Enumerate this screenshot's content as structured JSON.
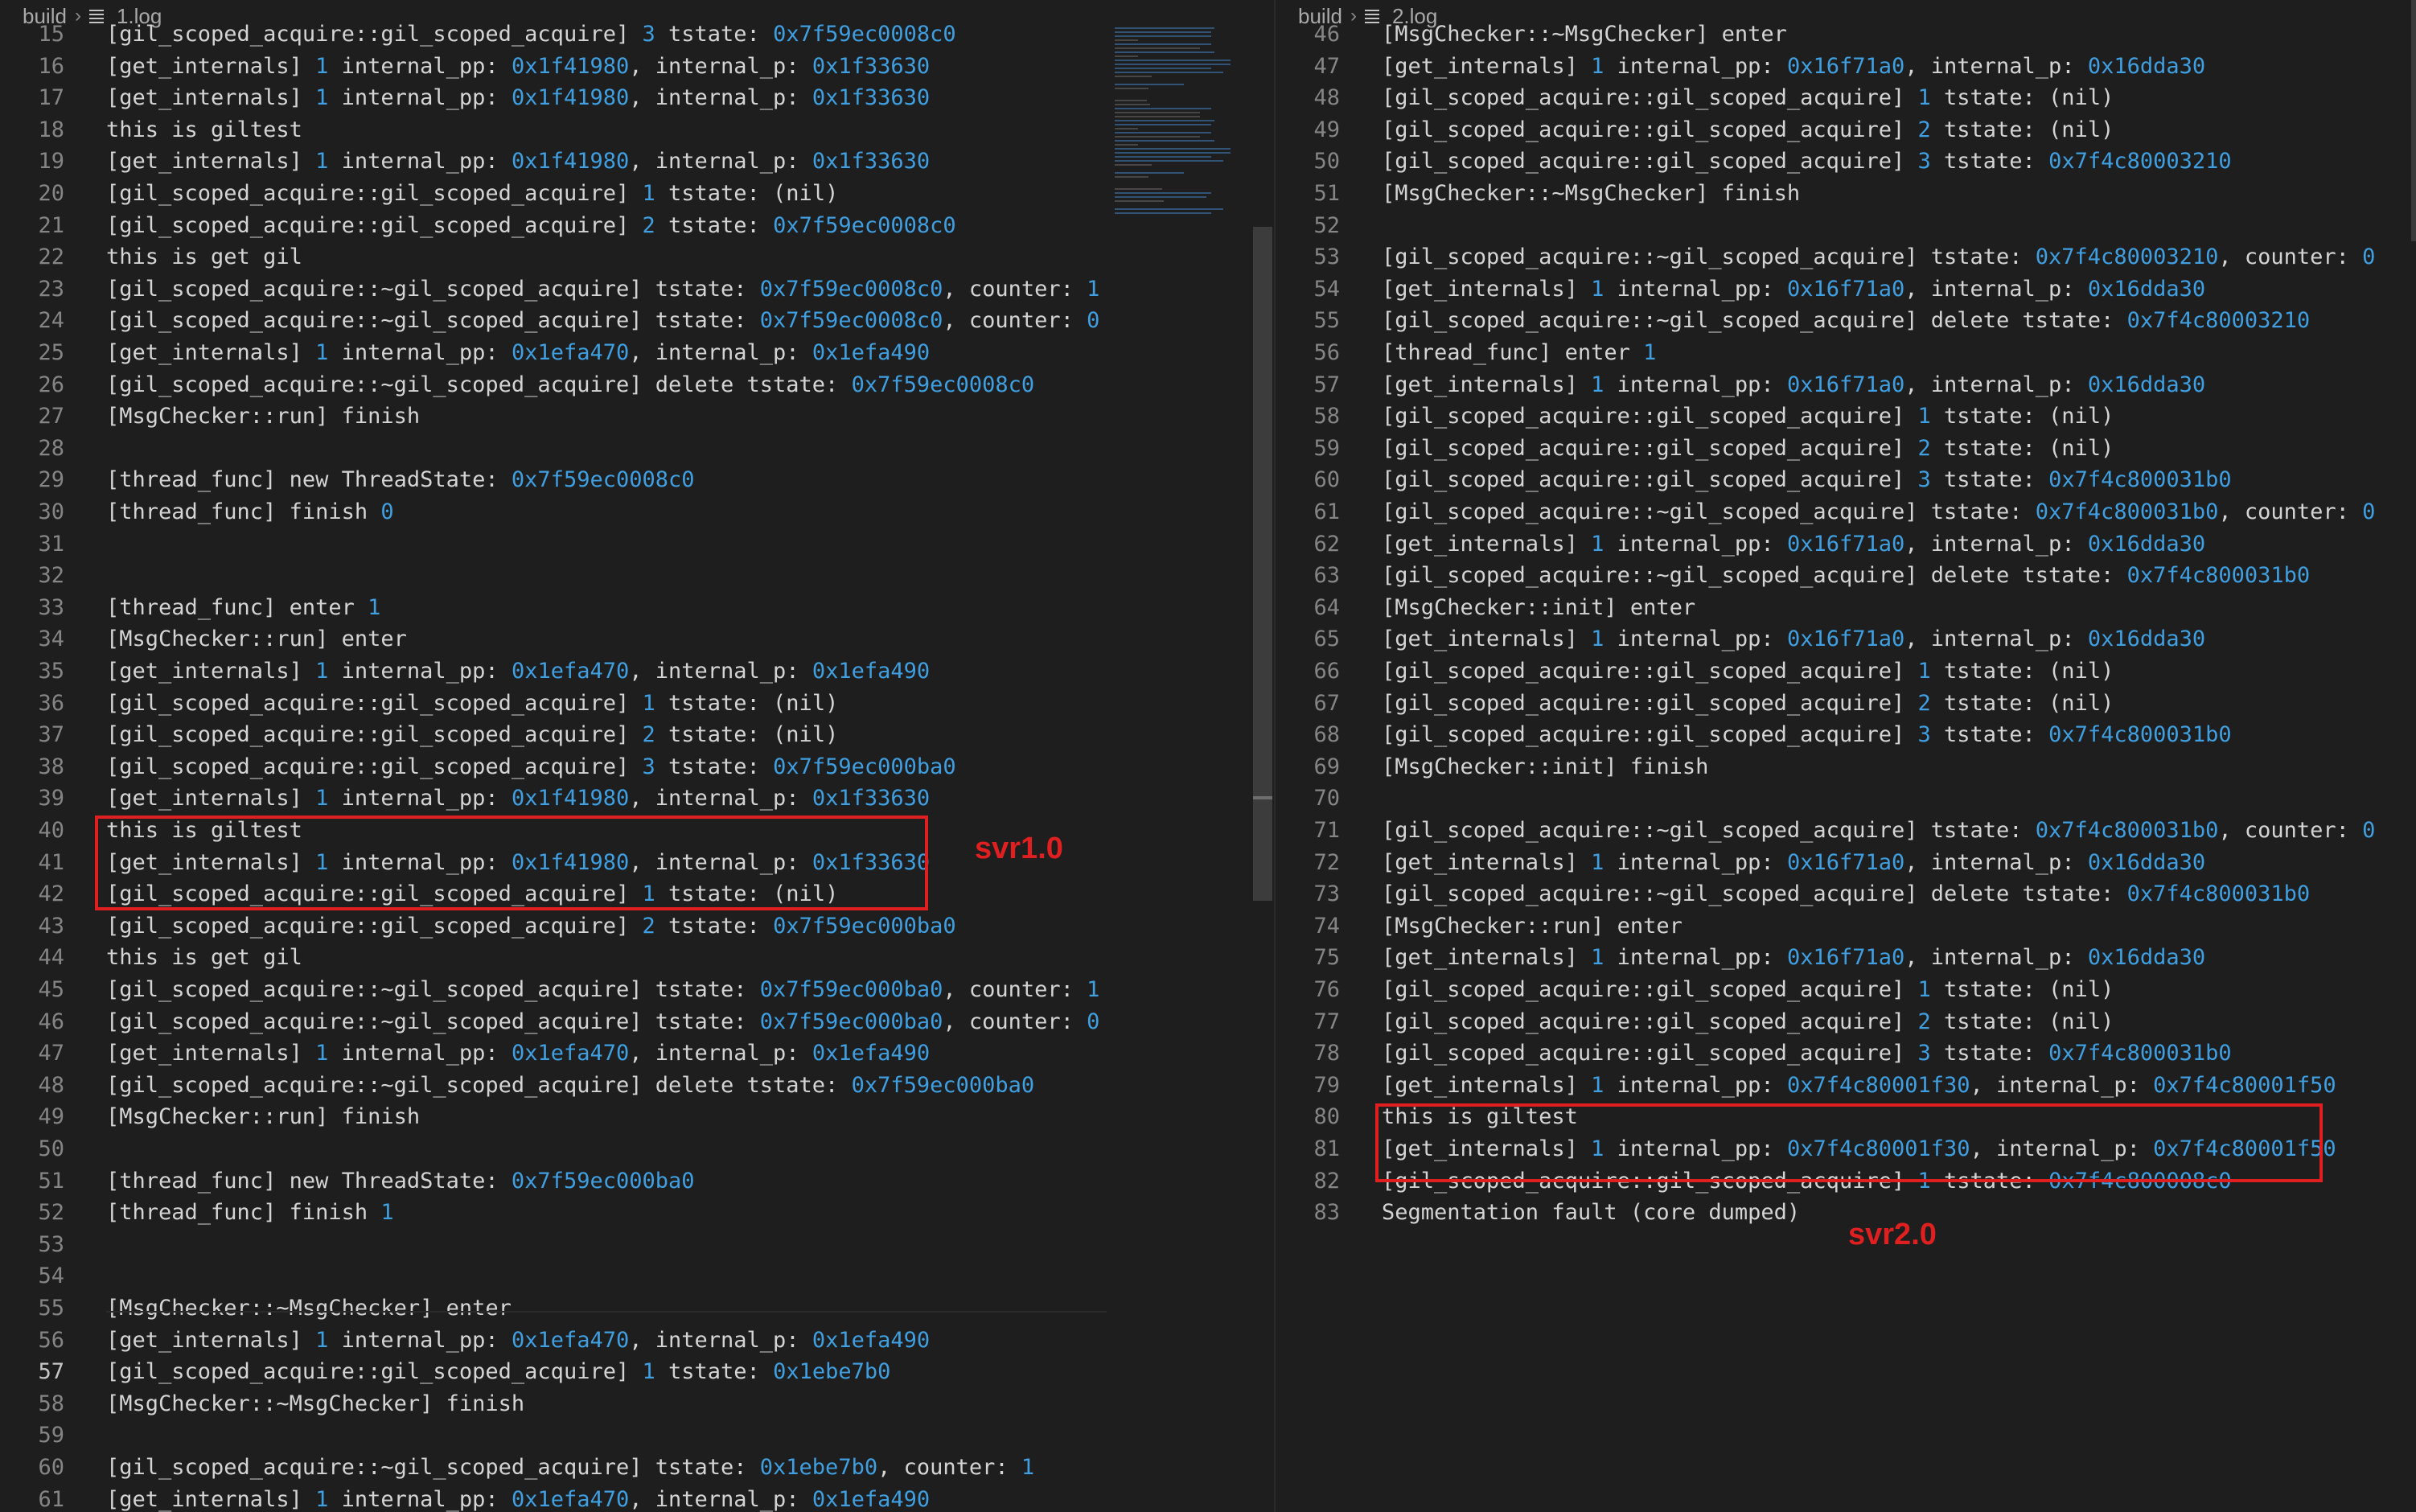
{
  "left": {
    "breadcrumb": {
      "folder": "build",
      "file": "1.log"
    },
    "annotation": "svr1.0",
    "active_line": 57,
    "lines": [
      {
        "n": 15,
        "t": "[gil_scoped_acquire::gil_scoped_acquire] 3 tstate: 0x7f59ec0008c0"
      },
      {
        "n": 16,
        "t": "[get_internals] 1 internal_pp: 0x1f41980, internal_p: 0x1f33630"
      },
      {
        "n": 17,
        "t": "[get_internals] 1 internal_pp: 0x1f41980, internal_p: 0x1f33630"
      },
      {
        "n": 18,
        "t": "this is giltest"
      },
      {
        "n": 19,
        "t": "[get_internals] 1 internal_pp: 0x1f41980, internal_p: 0x1f33630"
      },
      {
        "n": 20,
        "t": "[gil_scoped_acquire::gil_scoped_acquire] 1 tstate: (nil)"
      },
      {
        "n": 21,
        "t": "[gil_scoped_acquire::gil_scoped_acquire] 2 tstate: 0x7f59ec0008c0"
      },
      {
        "n": 22,
        "t": "this is get gil"
      },
      {
        "n": 23,
        "t": "[gil_scoped_acquire::~gil_scoped_acquire] tstate: 0x7f59ec0008c0, counter: 1"
      },
      {
        "n": 24,
        "t": "[gil_scoped_acquire::~gil_scoped_acquire] tstate: 0x7f59ec0008c0, counter: 0"
      },
      {
        "n": 25,
        "t": "[get_internals] 1 internal_pp: 0x1efa470, internal_p: 0x1efa490"
      },
      {
        "n": 26,
        "t": "[gil_scoped_acquire::~gil_scoped_acquire] delete tstate: 0x7f59ec0008c0"
      },
      {
        "n": 27,
        "t": "[MsgChecker::run] finish"
      },
      {
        "n": 28,
        "t": ""
      },
      {
        "n": 29,
        "t": "[thread_func] new ThreadState: 0x7f59ec0008c0"
      },
      {
        "n": 30,
        "t": "[thread_func] finish 0"
      },
      {
        "n": 31,
        "t": ""
      },
      {
        "n": 32,
        "t": ""
      },
      {
        "n": 33,
        "t": "[thread_func] enter 1"
      },
      {
        "n": 34,
        "t": "[MsgChecker::run] enter"
      },
      {
        "n": 35,
        "t": "[get_internals] 1 internal_pp: 0x1efa470, internal_p: 0x1efa490"
      },
      {
        "n": 36,
        "t": "[gil_scoped_acquire::gil_scoped_acquire] 1 tstate: (nil)"
      },
      {
        "n": 37,
        "t": "[gil_scoped_acquire::gil_scoped_acquire] 2 tstate: (nil)"
      },
      {
        "n": 38,
        "t": "[gil_scoped_acquire::gil_scoped_acquire] 3 tstate: 0x7f59ec000ba0"
      },
      {
        "n": 39,
        "t": "[get_internals] 1 internal_pp: 0x1f41980, internal_p: 0x1f33630"
      },
      {
        "n": 40,
        "t": "this is giltest"
      },
      {
        "n": 41,
        "t": "[get_internals] 1 internal_pp: 0x1f41980, internal_p: 0x1f33630"
      },
      {
        "n": 42,
        "t": "[gil_scoped_acquire::gil_scoped_acquire] 1 tstate: (nil)"
      },
      {
        "n": 43,
        "t": "[gil_scoped_acquire::gil_scoped_acquire] 2 tstate: 0x7f59ec000ba0"
      },
      {
        "n": 44,
        "t": "this is get gil"
      },
      {
        "n": 45,
        "t": "[gil_scoped_acquire::~gil_scoped_acquire] tstate: 0x7f59ec000ba0, counter: 1"
      },
      {
        "n": 46,
        "t": "[gil_scoped_acquire::~gil_scoped_acquire] tstate: 0x7f59ec000ba0, counter: 0"
      },
      {
        "n": 47,
        "t": "[get_internals] 1 internal_pp: 0x1efa470, internal_p: 0x1efa490"
      },
      {
        "n": 48,
        "t": "[gil_scoped_acquire::~gil_scoped_acquire] delete tstate: 0x7f59ec000ba0"
      },
      {
        "n": 49,
        "t": "[MsgChecker::run] finish"
      },
      {
        "n": 50,
        "t": ""
      },
      {
        "n": 51,
        "t": "[thread_func] new ThreadState: 0x7f59ec000ba0"
      },
      {
        "n": 52,
        "t": "[thread_func] finish 1"
      },
      {
        "n": 53,
        "t": ""
      },
      {
        "n": 54,
        "t": ""
      },
      {
        "n": 55,
        "t": "[MsgChecker::~MsgChecker] enter"
      },
      {
        "n": 56,
        "t": "[get_internals] 1 internal_pp: 0x1efa470, internal_p: 0x1efa490"
      },
      {
        "n": 57,
        "t": "[gil_scoped_acquire::gil_scoped_acquire] 1 tstate: 0x1ebe7b0"
      },
      {
        "n": 58,
        "t": "[MsgChecker::~MsgChecker] finish"
      },
      {
        "n": 59,
        "t": ""
      },
      {
        "n": 60,
        "t": "[gil_scoped_acquire::~gil_scoped_acquire] tstate: 0x1ebe7b0, counter: 1"
      },
      {
        "n": 61,
        "t": "[get_internals] 1 internal_pp: 0x1efa470, internal_p: 0x1efa490"
      },
      {
        "n": 62,
        "t": ""
      }
    ]
  },
  "right": {
    "breadcrumb": {
      "folder": "build",
      "file": "2.log"
    },
    "annotation": "svr2.0",
    "lines": [
      {
        "n": 46,
        "t": "[MsgChecker::~MsgChecker] enter"
      },
      {
        "n": 47,
        "t": "[get_internals] 1 internal_pp: 0x16f71a0, internal_p: 0x16dda30"
      },
      {
        "n": 48,
        "t": "[gil_scoped_acquire::gil_scoped_acquire] 1 tstate: (nil)"
      },
      {
        "n": 49,
        "t": "[gil_scoped_acquire::gil_scoped_acquire] 2 tstate: (nil)"
      },
      {
        "n": 50,
        "t": "[gil_scoped_acquire::gil_scoped_acquire] 3 tstate: 0x7f4c80003210"
      },
      {
        "n": 51,
        "t": "[MsgChecker::~MsgChecker] finish"
      },
      {
        "n": 52,
        "t": ""
      },
      {
        "n": 53,
        "t": "[gil_scoped_acquire::~gil_scoped_acquire] tstate: 0x7f4c80003210, counter: 0"
      },
      {
        "n": 54,
        "t": "[get_internals] 1 internal_pp: 0x16f71a0, internal_p: 0x16dda30"
      },
      {
        "n": 55,
        "t": "[gil_scoped_acquire::~gil_scoped_acquire] delete tstate: 0x7f4c80003210"
      },
      {
        "n": 56,
        "t": "[thread_func] enter 1"
      },
      {
        "n": 57,
        "t": "[get_internals] 1 internal_pp: 0x16f71a0, internal_p: 0x16dda30"
      },
      {
        "n": 58,
        "t": "[gil_scoped_acquire::gil_scoped_acquire] 1 tstate: (nil)"
      },
      {
        "n": 59,
        "t": "[gil_scoped_acquire::gil_scoped_acquire] 2 tstate: (nil)"
      },
      {
        "n": 60,
        "t": "[gil_scoped_acquire::gil_scoped_acquire] 3 tstate: 0x7f4c800031b0"
      },
      {
        "n": 61,
        "t": "[gil_scoped_acquire::~gil_scoped_acquire] tstate: 0x7f4c800031b0, counter: 0"
      },
      {
        "n": 62,
        "t": "[get_internals] 1 internal_pp: 0x16f71a0, internal_p: 0x16dda30"
      },
      {
        "n": 63,
        "t": "[gil_scoped_acquire::~gil_scoped_acquire] delete tstate: 0x7f4c800031b0"
      },
      {
        "n": 64,
        "t": "[MsgChecker::init] enter"
      },
      {
        "n": 65,
        "t": "[get_internals] 1 internal_pp: 0x16f71a0, internal_p: 0x16dda30"
      },
      {
        "n": 66,
        "t": "[gil_scoped_acquire::gil_scoped_acquire] 1 tstate: (nil)"
      },
      {
        "n": 67,
        "t": "[gil_scoped_acquire::gil_scoped_acquire] 2 tstate: (nil)"
      },
      {
        "n": 68,
        "t": "[gil_scoped_acquire::gil_scoped_acquire] 3 tstate: 0x7f4c800031b0"
      },
      {
        "n": 69,
        "t": "[MsgChecker::init] finish"
      },
      {
        "n": 70,
        "t": ""
      },
      {
        "n": 71,
        "t": "[gil_scoped_acquire::~gil_scoped_acquire] tstate: 0x7f4c800031b0, counter: 0"
      },
      {
        "n": 72,
        "t": "[get_internals] 1 internal_pp: 0x16f71a0, internal_p: 0x16dda30"
      },
      {
        "n": 73,
        "t": "[gil_scoped_acquire::~gil_scoped_acquire] delete tstate: 0x7f4c800031b0"
      },
      {
        "n": 74,
        "t": "[MsgChecker::run] enter"
      },
      {
        "n": 75,
        "t": "[get_internals] 1 internal_pp: 0x16f71a0, internal_p: 0x16dda30"
      },
      {
        "n": 76,
        "t": "[gil_scoped_acquire::gil_scoped_acquire] 1 tstate: (nil)"
      },
      {
        "n": 77,
        "t": "[gil_scoped_acquire::gil_scoped_acquire] 2 tstate: (nil)"
      },
      {
        "n": 78,
        "t": "[gil_scoped_acquire::gil_scoped_acquire] 3 tstate: 0x7f4c800031b0"
      },
      {
        "n": 79,
        "t": "[get_internals] 1 internal_pp: 0x7f4c80001f30, internal_p: 0x7f4c80001f50"
      },
      {
        "n": 80,
        "t": "this is giltest"
      },
      {
        "n": 81,
        "t": "[get_internals] 1 internal_pp: 0x7f4c80001f30, internal_p: 0x7f4c80001f50"
      },
      {
        "n": 82,
        "t": "[gil_scoped_acquire::gil_scoped_acquire] 1 tstate: 0x7f4c800008c0"
      },
      {
        "n": 83,
        "t": "Segmentation fault (core dumped)"
      }
    ]
  },
  "colors": {
    "background": "#1e1e1e",
    "text": "#d4d4d4",
    "number": "#3f9fe0",
    "line_number": "#858585",
    "highlight": "#e02020"
  }
}
